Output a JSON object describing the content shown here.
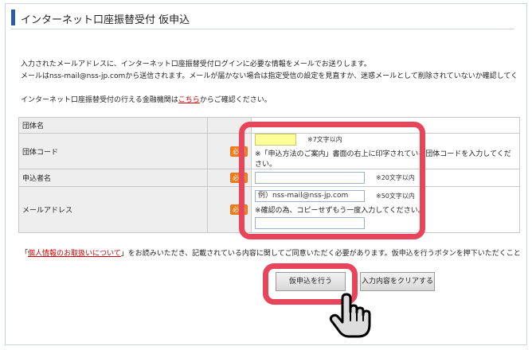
{
  "page": {
    "title": "インターネット口座振替受付 仮申込"
  },
  "intro": {
    "line1": "入力されたメールアドレスに、インターネット口座振替受付ログインに必要な情報をメールでお送りします。",
    "line2": "メールはnss-mail@nss-jp.comから送信されます。メールが届かない場合は指定受信の設定を見直すか、迷惑メールとして削除されていないか確認してく",
    "line3_prefix": "インターネット口座振替受付の行える金融機関は",
    "line3_link": "こちら",
    "line3_suffix": "からご確認ください。"
  },
  "form": {
    "rows": [
      {
        "label": "団体名"
      },
      {
        "label": "団体コード",
        "required": "必須",
        "hint": "※7文字以内",
        "note": "※「申込方法のご案内」書面の右上に印字されている団体コードを入力してください。"
      },
      {
        "label": "申込者名",
        "required": "必須",
        "hint": "※20文字以内"
      },
      {
        "label": "メールアドレス",
        "required": "必須",
        "placeholder": "例）nss-mail@nss-jp.com",
        "hint": "※50文字以内",
        "note": "※確認の為、コピーせずもう一度入力してください。"
      }
    ]
  },
  "privacy": {
    "bracket_open": "「",
    "link": "個人情報のお取扱いについて",
    "bracket_close": "」",
    "text": "をお読みいただき、記載されている内容に関してご同意いただく必要があります。仮申込を行うボタンを押下いただくこと"
  },
  "buttons": {
    "submit": "仮申込を行う",
    "clear": "入力内容をクリアする"
  },
  "colors": {
    "highlight": "#e9455a",
    "required_badge": "#f07a1a",
    "title_bar": "#2a5fa8",
    "code_input_fill": "#ffff99"
  }
}
